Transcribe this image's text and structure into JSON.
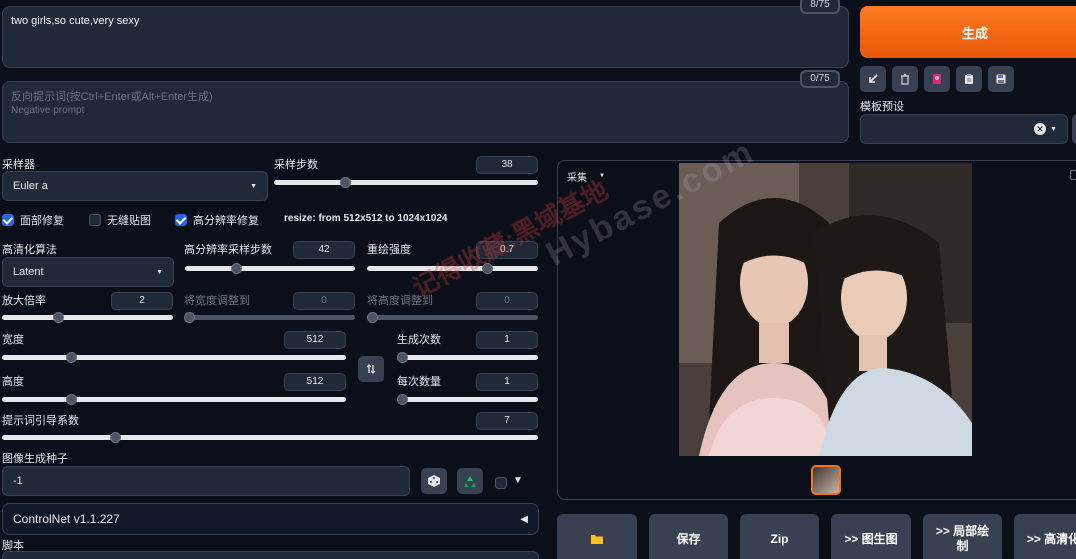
{
  "prompt": {
    "value": "two girls,so cute,very sexy",
    "token_count": "8/75"
  },
  "negative_prompt": {
    "placeholder_line1": "反向提示词(按Ctrl+Enter或Alt+Enter生成)",
    "placeholder_line2": "Negative prompt",
    "token_count": "0/75"
  },
  "generate": {
    "label": "生成",
    "color": "#f97316"
  },
  "template": {
    "label": "模板预设",
    "clear_icon": "close-icon",
    "arrow_icon": "chevron-down-icon"
  },
  "sampler": {
    "label": "采样器",
    "value": "Euler a"
  },
  "steps": {
    "label": "采样步数",
    "value": "38",
    "fraction": 0.27
  },
  "checkboxes": {
    "face_restore": {
      "label": "面部修复",
      "checked": true
    },
    "tiling": {
      "label": "无缝贴图",
      "checked": false
    },
    "hires_fix": {
      "label": "高分辨率修复",
      "checked": true
    }
  },
  "resize_info": "resize: from 512x512 to 1024x1024",
  "upscaler": {
    "label": "高清化算法",
    "value": "Latent"
  },
  "hires_steps": {
    "label": "高分辨率采样步数",
    "value": "42",
    "fraction": 0.3
  },
  "denoise": {
    "label": "重绘强度",
    "value": "0.7",
    "fraction": 0.7
  },
  "upscale_by": {
    "label": "放大倍率",
    "value": "2",
    "fraction": 0.33
  },
  "resize_width_to": {
    "label": "将宽度调整到",
    "value": "0"
  },
  "resize_height_to": {
    "label": "将高度调整到",
    "value": "0"
  },
  "width": {
    "label": "宽度",
    "value": "512",
    "fraction": 0.2
  },
  "height": {
    "label": "高度",
    "value": "512",
    "fraction": 0.2
  },
  "batch_count": {
    "label": "生成次数",
    "value": "1",
    "fraction": 0.0
  },
  "batch_size": {
    "label": "每次数量",
    "value": "1",
    "fraction": 0.0
  },
  "cfg": {
    "label": "提示词引导系数",
    "value": "7",
    "fraction": 0.21
  },
  "seed": {
    "label": "图像生成种子",
    "value": "-1"
  },
  "controlnet": {
    "label": "ControlNet v1.1.227"
  },
  "script": {
    "label": "脚本"
  },
  "output": {
    "tab_label": "采集"
  },
  "actions": [
    {
      "label": ""
    },
    {
      "label": "保存"
    },
    {
      "label": "Zip"
    },
    {
      "label": ">> 图生图"
    },
    {
      "label": ">> 局部绘\n制"
    },
    {
      "label": ">> 高清化"
    }
  ],
  "watermark": {
    "cn": "记得收藏:黑域基地",
    "en": "Hybase.com"
  }
}
